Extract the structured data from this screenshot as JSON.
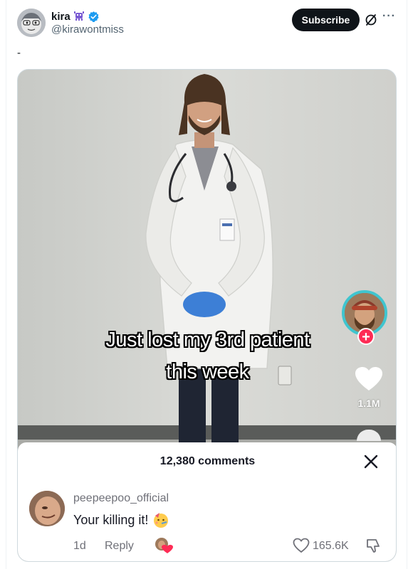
{
  "post": {
    "display_name": "kira",
    "handle": "@kirawontmiss",
    "text": "-",
    "subscribe_label": "Subscribe",
    "more_label": "···"
  },
  "icons": {
    "avatar": "avatar-cartoon",
    "badge": "alien-monster-icon",
    "verified": "verified-badge-icon",
    "grok": "grok-icon",
    "more": "more-icon"
  },
  "media": {
    "caption_line1": "Just lost my 3rd patient",
    "caption_line2": "this week",
    "like_count": "1.1M"
  },
  "comments": {
    "title": "12,380 comments",
    "items": [
      {
        "username": "peepeepoo_official",
        "text": "Your killing it!",
        "time": "1d",
        "reply_label": "Reply",
        "like_count": "165.6K"
      }
    ]
  },
  "colors": {
    "subscribe_bg": "#0f1419",
    "tiktok_red": "#fe2c55",
    "avatar_ring": "#40c5cf",
    "muted_text": "#6f7078"
  }
}
